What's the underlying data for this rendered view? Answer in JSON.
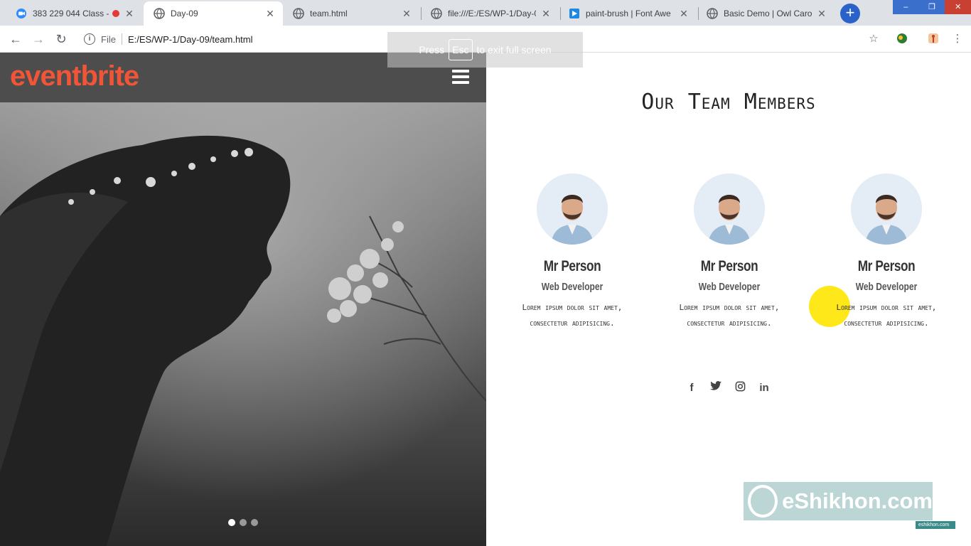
{
  "browser": {
    "tabs": [
      {
        "title": "383 229 044 Class - ",
        "active": false
      },
      {
        "title": "Day-09",
        "active": true
      },
      {
        "title": "team.html",
        "active": false
      },
      {
        "title": "file:///E:/ES/WP-1/Day-0",
        "active": false
      },
      {
        "title": "paint-brush | Font Awe",
        "active": false
      },
      {
        "title": "Basic Demo | Owl Carou",
        "active": false
      }
    ],
    "file_label": "File",
    "url": "E:/ES/WP-1/Day-09/team.html",
    "fullscreen_banner": {
      "press": "Press",
      "key": "Esc",
      "rest": "to exit full screen"
    }
  },
  "site": {
    "logo": "eventbrite",
    "brand_color": "#f05537",
    "team_title": "Our Team Members",
    "members": [
      {
        "name": "Mr Person",
        "role": "Web Developer",
        "desc_line1": "Lorem ipsum dolor sit amet,",
        "desc_line2": "consectetur adipisicing."
      },
      {
        "name": "Mr Person",
        "role": "Web Developer",
        "desc_line1": "Lorem ipsum dolor sit amet,",
        "desc_line2": "consectetur adipisicing."
      },
      {
        "name": "Mr Person",
        "role": "Web Developer",
        "desc_line1": "Lorem ipsum dolor sit amet,",
        "desc_line2": "consectetur adipisicing."
      }
    ],
    "socials": [
      "facebook-icon",
      "twitter-icon",
      "instagram-icon",
      "linkedin-icon"
    ],
    "carousel_dots": 3,
    "carousel_active": 1
  },
  "watermark": {
    "text": "eShikhon.com",
    "small": "eshikhon.com"
  }
}
